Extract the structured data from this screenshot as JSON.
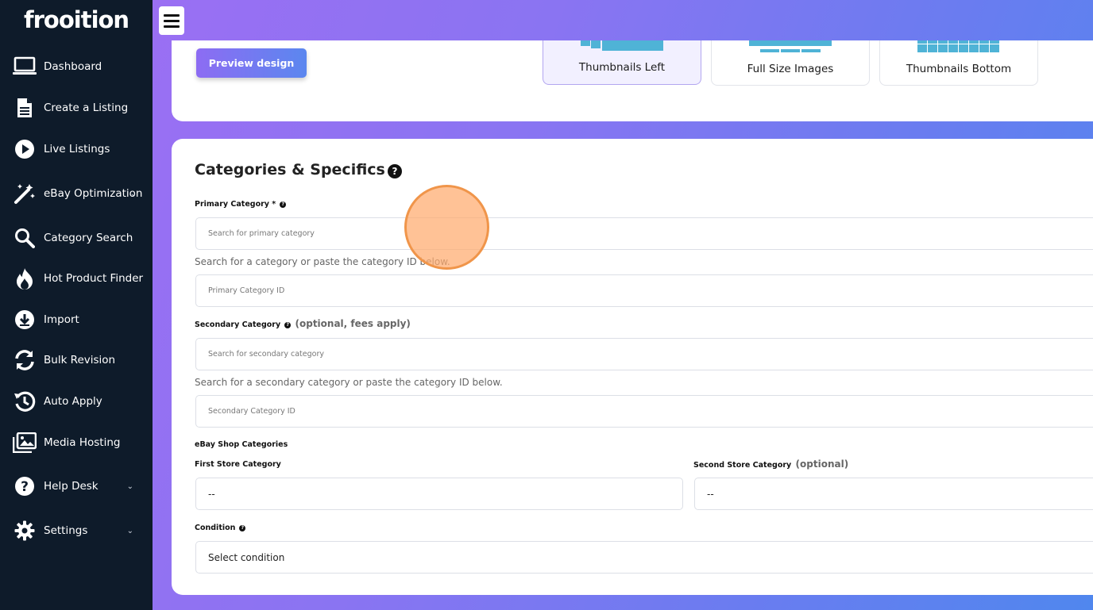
{
  "app": {
    "logo": "frooition"
  },
  "sidebar": {
    "items": [
      {
        "label": "Dashboard",
        "icon": "laptop-icon"
      },
      {
        "label": "Create a Listing",
        "icon": "document-icon"
      },
      {
        "label": "Live Listings",
        "icon": "play-icon"
      },
      {
        "label": "eBay Optimization",
        "icon": "magic-wand-icon"
      },
      {
        "label": "Category Search",
        "icon": "magnify-icon"
      },
      {
        "label": "Hot Product Finder",
        "icon": "fire-icon"
      },
      {
        "label": "Import",
        "icon": "download-icon"
      },
      {
        "label": "Bulk Revision",
        "icon": "sync-icon"
      },
      {
        "label": "Auto Apply",
        "icon": "history-icon"
      },
      {
        "label": "Media Hosting",
        "icon": "images-icon"
      },
      {
        "label": "Help Desk",
        "icon": "question-icon"
      },
      {
        "label": "Settings",
        "icon": "gear-icon"
      }
    ]
  },
  "design": {
    "preview_label": "Preview design",
    "layouts": [
      {
        "label": "Thumbnails Left",
        "selected": true
      },
      {
        "label": "Full Size Images",
        "selected": false
      },
      {
        "label": "Thumbnails Bottom",
        "selected": false
      }
    ]
  },
  "categories": {
    "title": "Categories & Specifics",
    "primary_label": "Primary Category *",
    "primary_search_placeholder": "Search for primary category",
    "primary_hint": "Search for a category or paste the category ID below.",
    "primary_id_placeholder": "Primary Category ID",
    "secondary_label": "Secondary Category",
    "secondary_optional": "(optional, fees apply)",
    "secondary_search_placeholder": "Search for secondary category",
    "secondary_hint": "Search for a secondary category or paste the category ID below.",
    "secondary_id_placeholder": "Secondary Category ID",
    "shop_label": "eBay Shop Categories",
    "first_store_label": "First Store Category",
    "first_store_value": "--",
    "second_store_label": "Second Store Category",
    "second_store_optional": "(optional)",
    "second_store_value": "--",
    "condition_label": "Condition",
    "condition_value": "Select condition"
  },
  "colors": {
    "sidebar_bg": "#0e1b2a",
    "accent": "#8d6cf3",
    "thumb": "#4fb3d6"
  }
}
